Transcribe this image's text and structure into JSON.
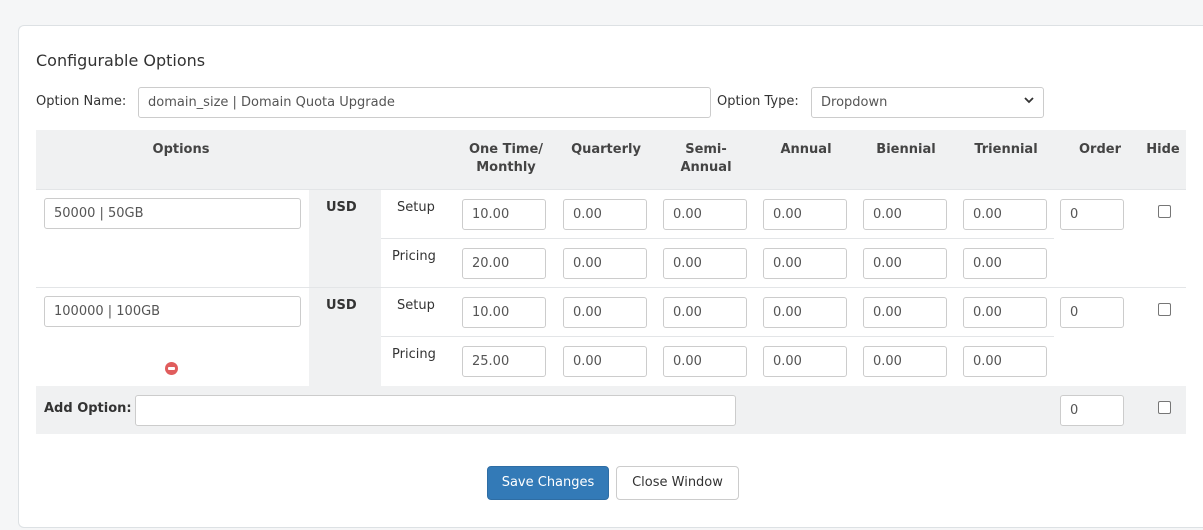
{
  "section_title": "Configurable Options",
  "option_name": {
    "label": "Option Name:",
    "value": "domain_size | Domain Quota Upgrade"
  },
  "option_type": {
    "label": "Option Type:",
    "value": "Dropdown"
  },
  "headers": {
    "options": "Options",
    "one_time_monthly": "One Time/\nMonthly",
    "quarterly": "Quarterly",
    "semi_annual": "Semi-\nAnnual",
    "annual": "Annual",
    "biennial": "Biennial",
    "triennial": "Triennial",
    "order": "Order",
    "hide": "Hide"
  },
  "rows": [
    {
      "name": "50000 | 50GB",
      "currency": "USD",
      "setup_label": "Setup",
      "pricing_label": "Pricing",
      "setup": [
        "10.00",
        "0.00",
        "0.00",
        "0.00",
        "0.00",
        "0.00"
      ],
      "pricing": [
        "20.00",
        "0.00",
        "0.00",
        "0.00",
        "0.00",
        "0.00"
      ],
      "order": "0",
      "hide": false
    },
    {
      "name": "100000 | 100GB",
      "currency": "USD",
      "setup_label": "Setup",
      "pricing_label": "Pricing",
      "setup": [
        "10.00",
        "0.00",
        "0.00",
        "0.00",
        "0.00",
        "0.00"
      ],
      "pricing": [
        "25.00",
        "0.00",
        "0.00",
        "0.00",
        "0.00",
        "0.00"
      ],
      "order": "0",
      "hide": false
    }
  ],
  "add_option": {
    "label": "Add Option:",
    "value": "",
    "order": "0",
    "hide": false
  },
  "buttons": {
    "save": "Save Changes",
    "close": "Close Window"
  },
  "icons": {
    "remove": "remove-icon",
    "chevron": "chevron-down-icon"
  },
  "colors": {
    "primary": "#337ab7",
    "remove": "#e05d5d",
    "header_bg": "#f0f1f2"
  }
}
